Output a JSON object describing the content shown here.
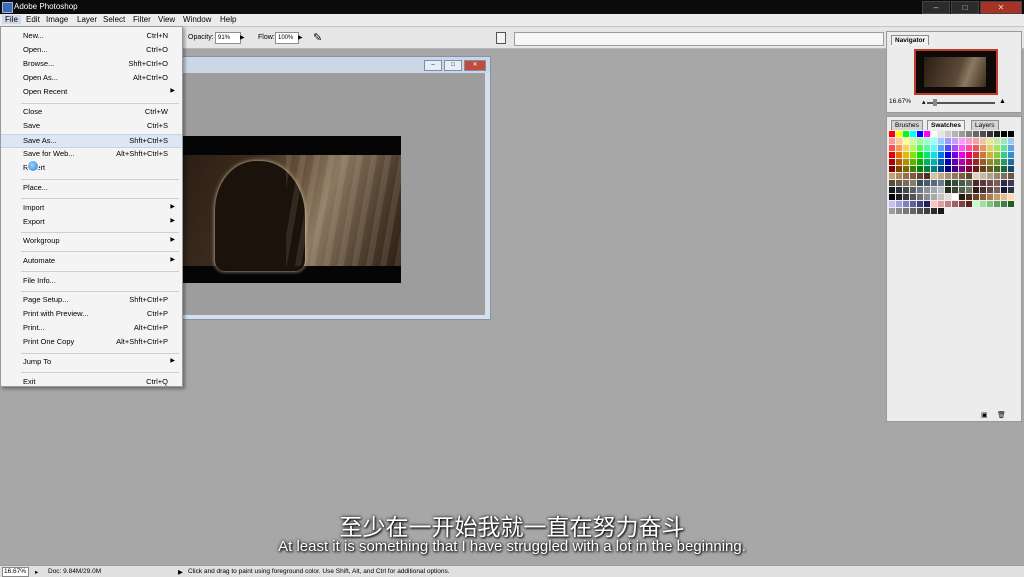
{
  "app": {
    "title": "Adobe Photoshop"
  },
  "window_controls": {
    "minimize": "–",
    "maximize": "□",
    "close": "✕"
  },
  "menubar": {
    "items": [
      "File",
      "Edit",
      "Image",
      "Layer",
      "Select",
      "Filter",
      "View",
      "Window",
      "Help"
    ],
    "active": "File"
  },
  "options": {
    "opacity_label": "Opacity:",
    "opacity_value": "91%",
    "flow_label": "Flow:",
    "flow_value": "100%",
    "airbrush_icon": "airbrush-icon"
  },
  "file_menu": {
    "items": [
      {
        "label": "New...",
        "shortcut": "Ctrl+N"
      },
      {
        "label": "Open...",
        "shortcut": "Ctrl+O"
      },
      {
        "label": "Browse...",
        "shortcut": "Shft+Ctrl+O"
      },
      {
        "label": "Open As...",
        "shortcut": "Alt+Ctrl+O"
      },
      {
        "label": "Open Recent",
        "shortcut": "",
        "submenu": true
      },
      {
        "separator": true
      },
      {
        "label": "Close",
        "shortcut": "Ctrl+W"
      },
      {
        "label": "Save",
        "shortcut": "Ctrl+S"
      },
      {
        "label": "Save As...",
        "shortcut": "Shft+Ctrl+S",
        "highlighted": true
      },
      {
        "label": "Save for Web...",
        "shortcut": "Alt+Shft+Ctrl+S"
      },
      {
        "label": "Revert",
        "shortcut": ""
      },
      {
        "separator": true
      },
      {
        "label": "Place...",
        "shortcut": ""
      },
      {
        "separator": true
      },
      {
        "label": "Import",
        "shortcut": "",
        "submenu": true
      },
      {
        "label": "Export",
        "shortcut": "",
        "submenu": true
      },
      {
        "separator": true
      },
      {
        "label": "Workgroup",
        "shortcut": "",
        "submenu": true
      },
      {
        "separator": true
      },
      {
        "label": "Automate",
        "shortcut": "",
        "submenu": true
      },
      {
        "separator": true
      },
      {
        "label": "File Info...",
        "shortcut": ""
      },
      {
        "separator": true
      },
      {
        "label": "Page Setup...",
        "shortcut": "Shft+Ctrl+P"
      },
      {
        "label": "Print with Preview...",
        "shortcut": "Ctrl+P"
      },
      {
        "label": "Print...",
        "shortcut": "Alt+Ctrl+P"
      },
      {
        "label": "Print One Copy",
        "shortcut": "Alt+Shft+Ctrl+P"
      },
      {
        "separator": true
      },
      {
        "label": "Jump To",
        "shortcut": "",
        "submenu": true
      },
      {
        "separator": true
      },
      {
        "label": "Exit",
        "shortcut": "Ctrl+Q"
      }
    ]
  },
  "document": {
    "controls": {
      "minimize": "–",
      "maximize": "□",
      "close": "✕"
    }
  },
  "navigator": {
    "tab": "Navigator",
    "zoom": "16.67%"
  },
  "swatches_panel": {
    "tabs": [
      "Brushes",
      "Swatches",
      "Layers"
    ],
    "active_tab": "Swatches"
  },
  "subtitles": {
    "chinese": "至少在一开始我就一直在努力奋斗",
    "english": "At least it is something that I have struggled with a lot in the beginning."
  },
  "statusbar": {
    "zoom": "16.67%",
    "doc": "Doc: 9.84M/29.0M",
    "hint": "Click and drag to paint using foreground color.  Use Shift, Alt, and Ctrl for additional options."
  },
  "colors": {
    "workspace": "#a7a7a7",
    "menu_highlight": "#dde6f3",
    "navigator_frame": "#c0392b"
  }
}
